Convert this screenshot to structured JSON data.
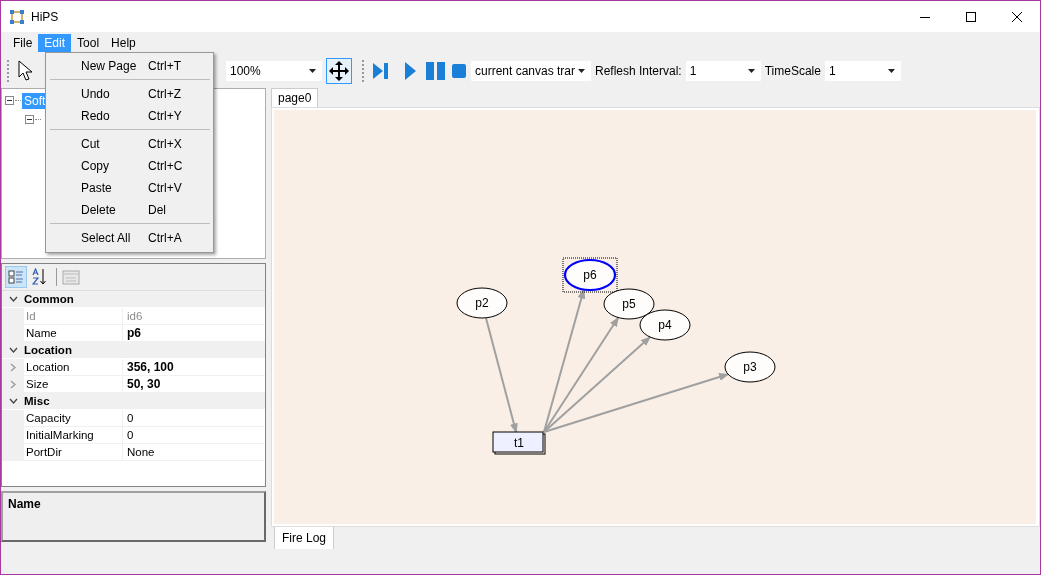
{
  "window": {
    "title": "HiPS"
  },
  "menu_bar": [
    {
      "label": "File",
      "selected": false
    },
    {
      "label": "Edit",
      "selected": true
    },
    {
      "label": "Tool",
      "selected": false
    },
    {
      "label": "Help",
      "selected": false
    }
  ],
  "open_menu": [
    {
      "kind": "item",
      "label": "New Page",
      "shortcut": "Ctrl+T"
    },
    {
      "kind": "separator"
    },
    {
      "kind": "item",
      "label": "Undo",
      "shortcut": "Ctrl+Z"
    },
    {
      "kind": "item",
      "label": "Redo",
      "shortcut": "Ctrl+Y"
    },
    {
      "kind": "separator"
    },
    {
      "kind": "item",
      "label": "Cut",
      "shortcut": "Ctrl+X"
    },
    {
      "kind": "item",
      "label": "Copy",
      "shortcut": "Ctrl+C"
    },
    {
      "kind": "item",
      "label": "Paste",
      "shortcut": "Ctrl+V"
    },
    {
      "kind": "item",
      "label": "Delete",
      "shortcut": "Del"
    },
    {
      "kind": "separator"
    },
    {
      "kind": "item",
      "label": "Select All",
      "shortcut": "Ctrl+A"
    }
  ],
  "toolbar": {
    "zoom": {
      "value": "100%"
    },
    "move_tool": {
      "selected": true
    },
    "mode": {
      "value": "current canvas trar"
    },
    "interval": {
      "label": "Reflesh Interval:",
      "value": "1"
    },
    "timescale": {
      "label": "TimeScale",
      "value": "1"
    }
  },
  "tree": [
    {
      "label": "Soft",
      "selected": true,
      "expanded": true,
      "children": [
        {
          "expanded": true
        }
      ]
    }
  ],
  "property_sort": [
    {
      "selected": true
    },
    {
      "selected": false
    }
  ],
  "properties": [
    {
      "kind": "category",
      "label": "Common"
    },
    {
      "kind": "property",
      "name": "Id",
      "value": "id6",
      "disabled": true,
      "bold": false,
      "expandable": false
    },
    {
      "kind": "property",
      "name": "Name",
      "value": "p6",
      "disabled": false,
      "bold": true,
      "expandable": false
    },
    {
      "kind": "category",
      "label": "Location"
    },
    {
      "kind": "property",
      "name": "Location",
      "value": "356, 100",
      "disabled": false,
      "bold": true,
      "expandable": true
    },
    {
      "kind": "property",
      "name": "Size",
      "value": "50, 30",
      "disabled": false,
      "bold": true,
      "expandable": true
    },
    {
      "kind": "category",
      "label": "Misc"
    },
    {
      "kind": "property",
      "name": "Capacity",
      "value": "0",
      "disabled": false,
      "bold": false,
      "expandable": false
    },
    {
      "kind": "property",
      "name": "InitialMarking",
      "value": "0",
      "disabled": false,
      "bold": false,
      "expandable": false
    },
    {
      "kind": "property",
      "name": "PortDir",
      "value": "None",
      "disabled": false,
      "bold": false,
      "expandable": false
    }
  ],
  "description": {
    "title": "Name"
  },
  "document_tabs": [
    {
      "label": "page0",
      "selected": true
    }
  ],
  "nodes": [
    {
      "kind": "place",
      "label": "p6",
      "selected": true
    },
    {
      "kind": "place",
      "label": "p2",
      "selected": false
    },
    {
      "kind": "place",
      "label": "p5",
      "selected": false
    },
    {
      "kind": "place",
      "label": "p4",
      "selected": false
    },
    {
      "kind": "place",
      "label": "p3",
      "selected": false
    },
    {
      "kind": "transition",
      "label": "t1",
      "selected": false
    }
  ],
  "bottom_tabs": [
    {
      "label": "Fire Log",
      "selected": true
    }
  ]
}
